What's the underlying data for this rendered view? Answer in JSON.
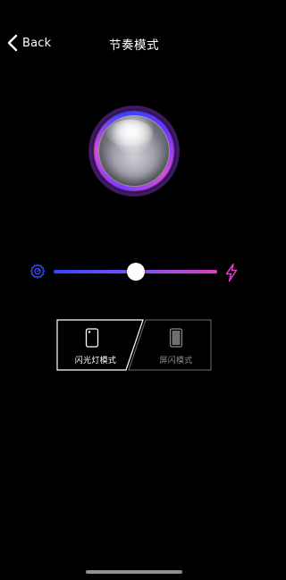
{
  "header": {
    "back_label": "Back",
    "title": "节奏模式"
  },
  "orb": {
    "ring_colors": [
      "#3a43ff",
      "#7a3cff",
      "#d84bd6"
    ]
  },
  "speed_slider": {
    "min_icon": "slow-gear-icon",
    "max_icon": "lightning-icon",
    "value": 0.5,
    "track_gradient": [
      "#3347ff",
      "#7d52f4",
      "#e23dc8"
    ]
  },
  "modes": [
    {
      "id": "flash",
      "label": "闪光灯模式",
      "icon": "phone-flashlight-icon",
      "selected": true
    },
    {
      "id": "screen",
      "label": "屏闪模式",
      "icon": "phone-screen-icon",
      "selected": false
    }
  ],
  "colors": {
    "background": "#000000",
    "accent_blue": "#3347ff",
    "accent_pink": "#e23dc8",
    "text": "#ffffff",
    "inactive": "#8a8a8a"
  }
}
